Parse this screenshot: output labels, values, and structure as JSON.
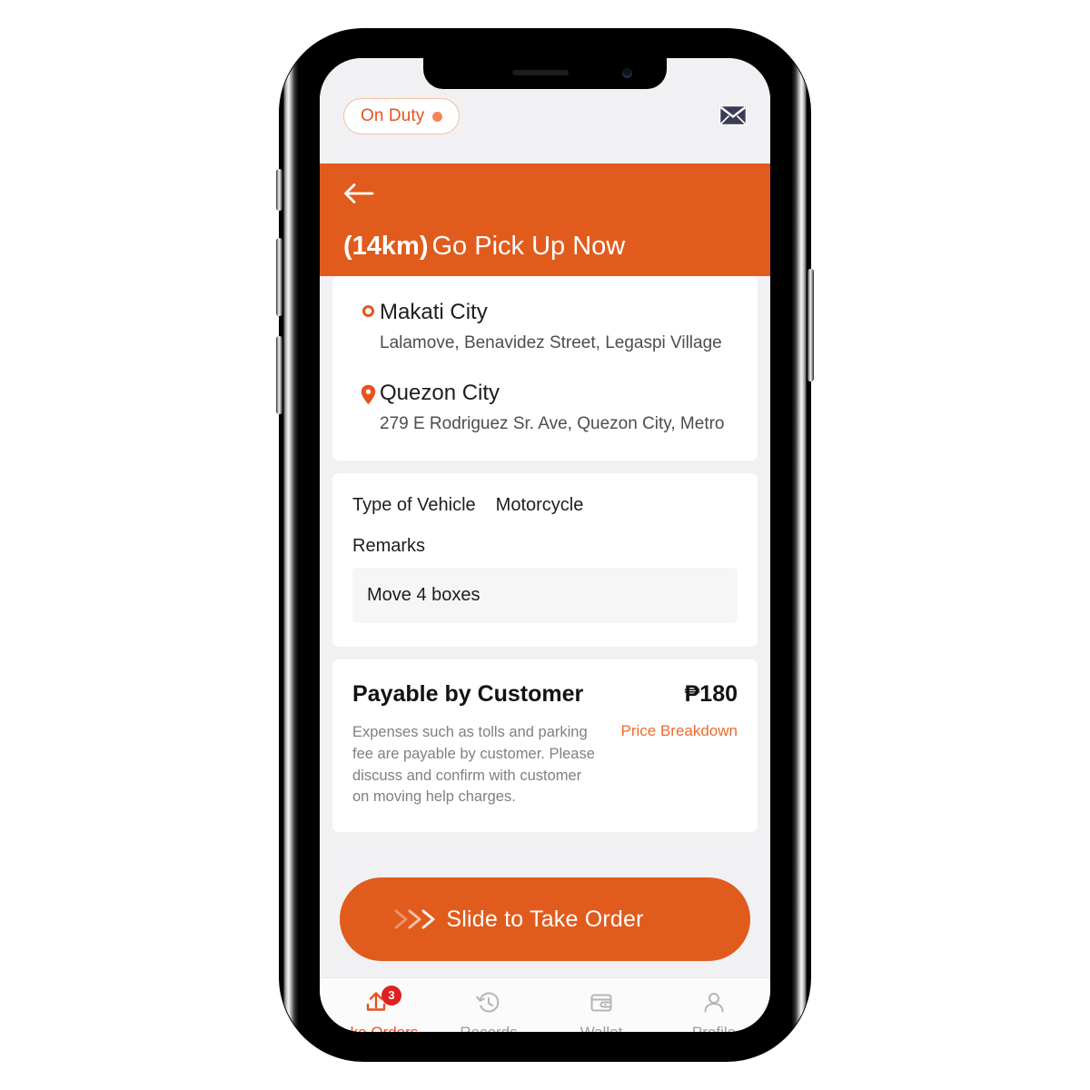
{
  "status_bar": {
    "duty_label": "On Duty",
    "duty_dot_icon": "status-dot-icon",
    "mail_icon": "envelope-icon"
  },
  "header": {
    "back_icon": "back-arrow-icon",
    "distance": "(14km)",
    "title": "Go Pick Up Now",
    "background_color": "#e15b1d"
  },
  "addresses": [
    {
      "icon": "pickup-circle-icon",
      "city": "Makati City",
      "detail": "Lalamove, Benavidez Street, Legaspi Village"
    },
    {
      "icon": "dropoff-pin-icon",
      "city": "Quezon City",
      "detail": "279 E Rodriguez Sr. Ave, Quezon City, Metro"
    }
  ],
  "order_details": {
    "vehicle_label": "Type of Vehicle",
    "vehicle_value": "Motorcycle",
    "remarks_label": "Remarks",
    "remarks_value": "Move 4 boxes"
  },
  "pricing": {
    "title": "Payable by Customer",
    "amount": "₱180",
    "note": "Expenses such as tolls and parking fee are payable by customer. Please discuss and confirm with customer on moving help charges.",
    "breakdown_link": "Price Breakdown",
    "accent_color": "#ef6a2a"
  },
  "slider": {
    "label": "Slide to Take Order",
    "chevrons_icon": "double-chevron-right-icon",
    "color": "#e15b1d"
  },
  "bottom_nav": {
    "items": [
      {
        "label": "Take Orders",
        "icon": "upload-tray-icon",
        "badge": "3",
        "active": true
      },
      {
        "label": "Records",
        "icon": "history-clock-icon",
        "badge": "",
        "active": false
      },
      {
        "label": "Wallet",
        "icon": "wallet-icon",
        "badge": "",
        "active": false
      },
      {
        "label": "Profile",
        "icon": "person-icon",
        "badge": "",
        "active": false
      }
    ]
  },
  "colors": {
    "brand_orange": "#e15b1d",
    "accent_orange": "#e8521d",
    "screen_bg": "#f1f1f3",
    "card_bg": "#ffffff",
    "badge_red": "#dd2222"
  }
}
